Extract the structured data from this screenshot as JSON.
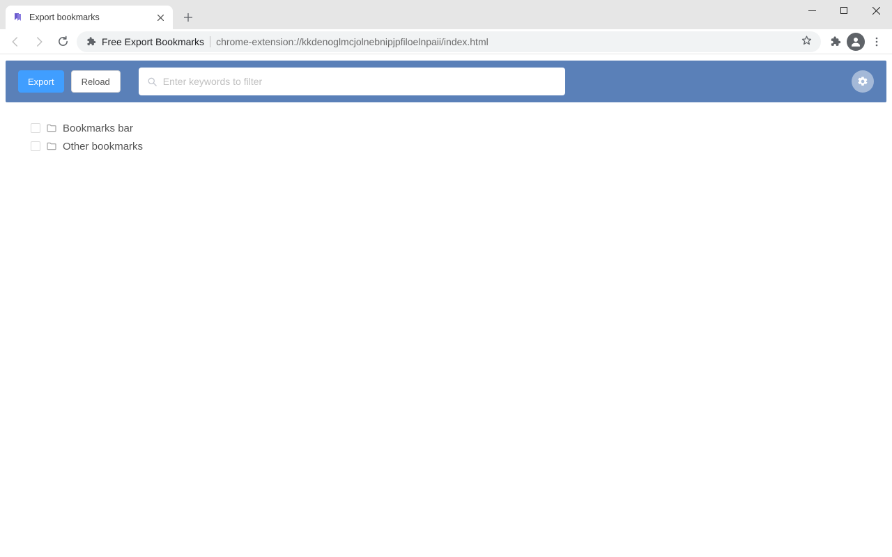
{
  "browser": {
    "tab_title": "Export bookmarks",
    "extension_name": "Free Export Bookmarks",
    "url": "chrome-extension://kkdenoglmcjolnebnipjpfiloelnpaii/index.html"
  },
  "toolbar": {
    "export_label": "Export",
    "reload_label": "Reload",
    "search_placeholder": "Enter keywords to filter"
  },
  "tree": {
    "items": [
      {
        "label": "Bookmarks bar"
      },
      {
        "label": "Other bookmarks"
      }
    ]
  }
}
